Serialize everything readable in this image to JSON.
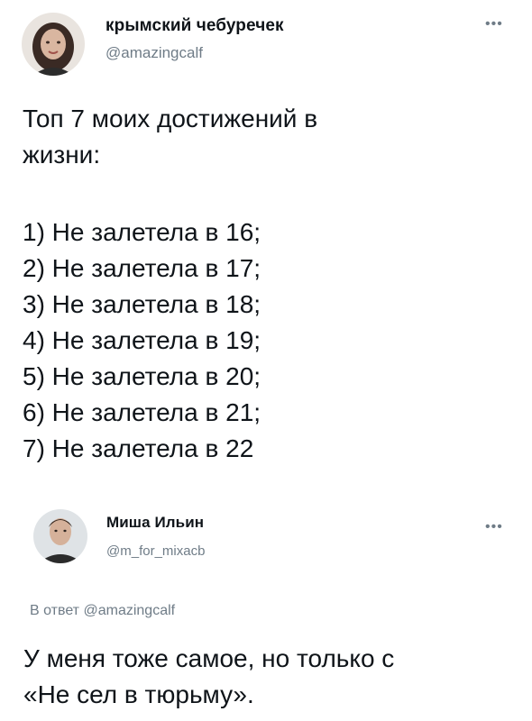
{
  "tweet1": {
    "author_name": "крымский чебуречек",
    "author_handle": "@amazingcalf",
    "more_icon": "more-dots-icon",
    "more_glyph": "•••",
    "text_lines": [
      "Топ 7 моих достижений в",
      "жизни:"
    ],
    "list": [
      "1) Не залетела в 16;",
      "2) Не залетела в 17;",
      "3) Не залетела в 18;",
      "4) Не залетела в 19;",
      "5) Не залетела в 20;",
      "6) Не залетела в 21;",
      "7) Не залетела в 22"
    ]
  },
  "tweet2": {
    "author_name": "Миша Ильин",
    "author_handle": "@m_for_mixacb",
    "more_icon": "more-dots-icon",
    "more_glyph": "•••",
    "reply_prefix": "В ответ",
    "reply_handle": "@amazingcalf",
    "text_lines": [
      "У меня тоже самое, но только с",
      "«Не сел в тюрьму»."
    ]
  },
  "colors": {
    "text": "#0f1419",
    "secondary": "#6f7c87",
    "background": "#ffffff"
  }
}
